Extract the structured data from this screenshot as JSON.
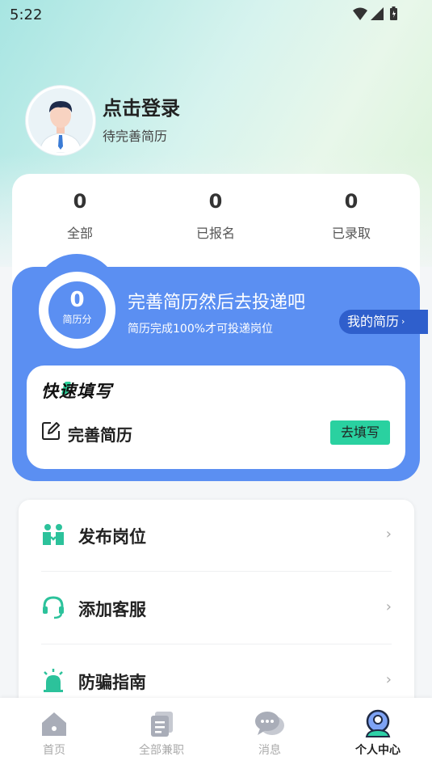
{
  "status_bar": {
    "time": "5:22"
  },
  "profile": {
    "title": "点击登录",
    "subtitle": "待完善简历"
  },
  "stats": [
    {
      "value": "0",
      "label": "全部"
    },
    {
      "value": "0",
      "label": "已报名"
    },
    {
      "value": "0",
      "label": "已录取"
    }
  ],
  "resume_card": {
    "score": "0",
    "score_label": "简历分",
    "title": "完善简历然后去投递吧",
    "subtitle": "简历完成100%才可投递岗位",
    "my_resume_label": "我的简历",
    "chevron": "›"
  },
  "quick_fill": {
    "title": "快速填写",
    "item_label": "完善简历",
    "button_label": "去填写"
  },
  "menu": [
    {
      "label": "发布岗位",
      "icon": "people-icon"
    },
    {
      "label": "添加客服",
      "icon": "headset-icon"
    },
    {
      "label": "防骗指南",
      "icon": "alarm-icon"
    }
  ],
  "menu_chevron": "›",
  "bottom_nav": [
    {
      "label": "首页",
      "icon": "home-icon",
      "active": false
    },
    {
      "label": "全部兼职",
      "icon": "document-icon",
      "active": false
    },
    {
      "label": "消息",
      "icon": "chat-icon",
      "active": false
    },
    {
      "label": "个人中心",
      "icon": "profile-icon",
      "active": true
    }
  ],
  "colors": {
    "primary_blue": "#5b8ff2",
    "dark_blue": "#2f5fcc",
    "accent_green": "#2ad1a0",
    "icon_teal": "#2cc29b"
  }
}
